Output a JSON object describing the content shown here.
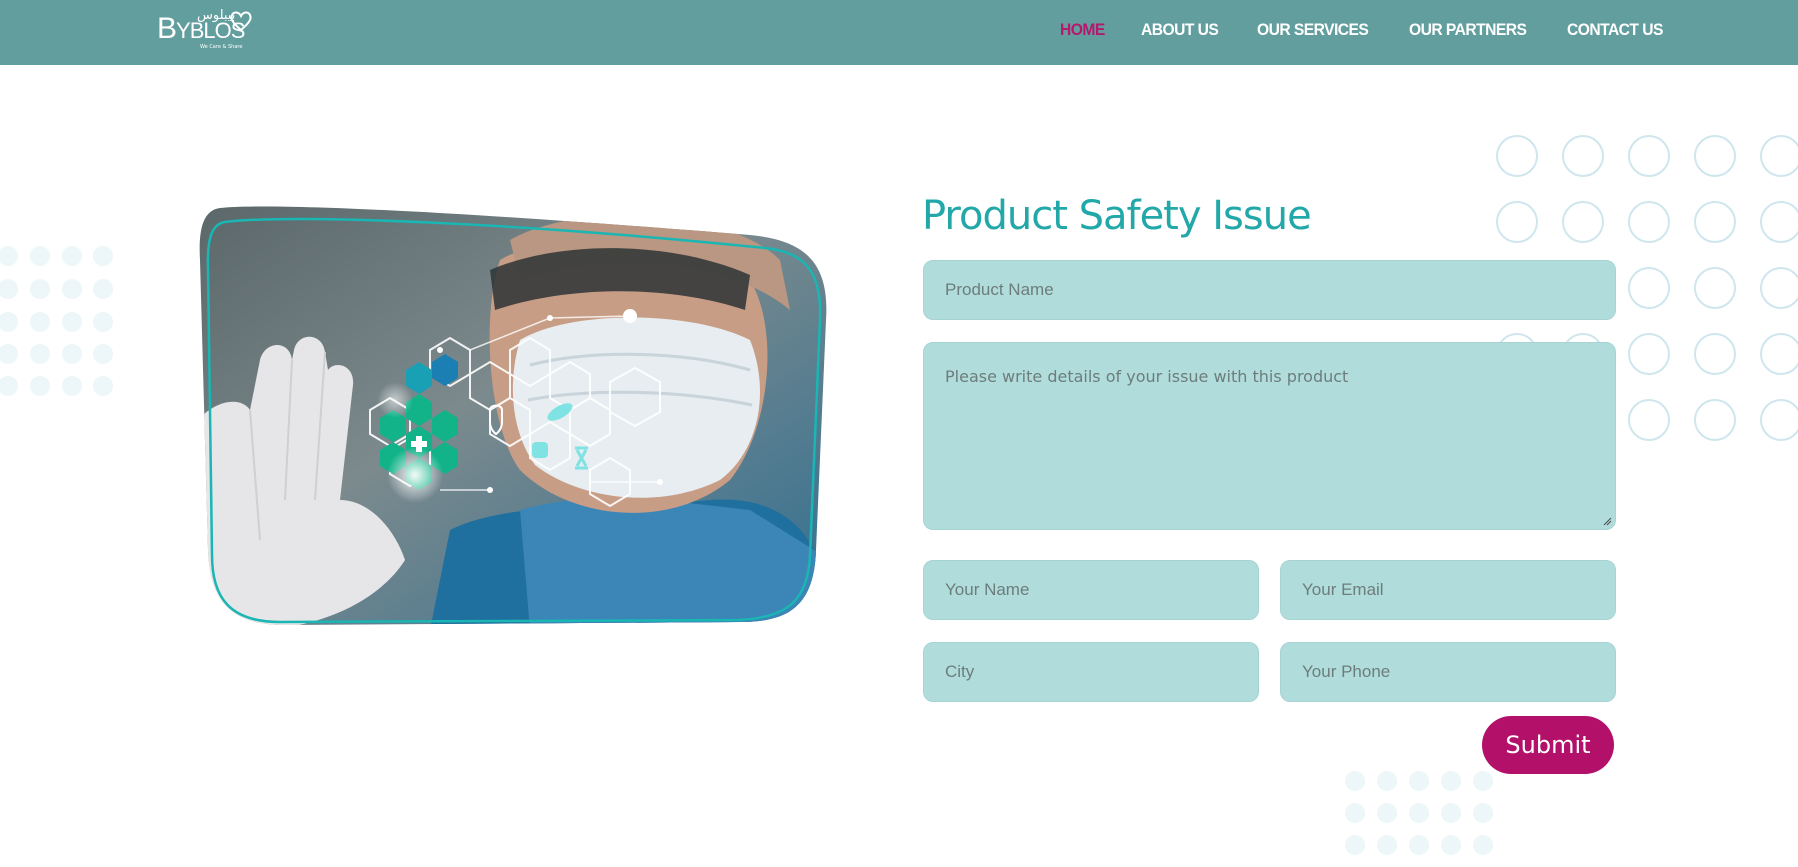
{
  "brand": {
    "logo_text": "BYBLOS",
    "logo_arabic": "بيبلوس",
    "logo_tagline": "We Care & Share"
  },
  "nav": {
    "items": [
      {
        "label": "HOME",
        "active": true
      },
      {
        "label": "ABOUT US",
        "active": false
      },
      {
        "label": "OUR SERVICES",
        "active": false
      },
      {
        "label": "OUR PARTNERS",
        "active": false
      },
      {
        "label": "CONTACT US",
        "active": false
      }
    ]
  },
  "form": {
    "title": "Product Safety Issue",
    "product_name_placeholder": "Product Name",
    "details_placeholder": "Please write details of your issue with this product",
    "name_placeholder": "Your Name",
    "email_placeholder": "Your Email",
    "city_placeholder": "City",
    "phone_placeholder": "Your Phone",
    "submit_label": "Submit"
  },
  "colors": {
    "header_bg": "#639e9e",
    "nav_active": "#b5186c",
    "title": "#22a8a8",
    "field_bg": "#b0dcdb",
    "submit_bg": "#b3106a"
  },
  "image": {
    "icon": "medical-hexagon-illustration"
  }
}
